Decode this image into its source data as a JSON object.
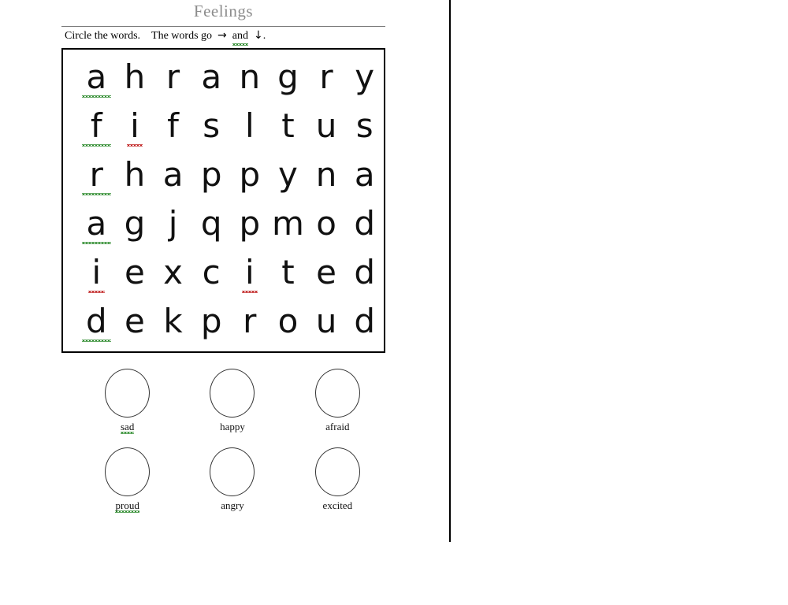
{
  "document": {
    "title": "Feelings",
    "instructions": {
      "part1": "Circle the words.",
      "part2": "The words go",
      "arrow_right": "→",
      "and_word": "and",
      "arrow_down": "↓",
      "period": "."
    }
  },
  "puzzle": {
    "rows": [
      [
        "a",
        "h",
        "r",
        "a",
        "n",
        "g",
        "r",
        "y"
      ],
      [
        "f",
        "i",
        "f",
        "s",
        "l",
        "t",
        "u",
        "s"
      ],
      [
        "r",
        "h",
        "a",
        "p",
        "p",
        "y",
        "n",
        "a"
      ],
      [
        "a",
        "g",
        "j",
        "q",
        "p",
        "m",
        "o",
        "d"
      ],
      [
        "i",
        "e",
        "x",
        "c",
        "i",
        "t",
        "e",
        "d"
      ],
      [
        "d",
        "e",
        "k",
        "p",
        "r",
        "o",
        "u",
        "d"
      ]
    ],
    "spellcheck_marks": [
      {
        "row": 0,
        "col": 0,
        "color": "green"
      },
      {
        "row": 1,
        "col": 0,
        "color": "green"
      },
      {
        "row": 1,
        "col": 1,
        "color": "red"
      },
      {
        "row": 2,
        "col": 0,
        "color": "green"
      },
      {
        "row": 3,
        "col": 0,
        "color": "green"
      },
      {
        "row": 4,
        "col": 0,
        "color": "red"
      },
      {
        "row": 4,
        "col": 4,
        "color": "red"
      },
      {
        "row": 5,
        "col": 0,
        "color": "green"
      }
    ]
  },
  "word_bank": {
    "rows": [
      [
        {
          "word": "sad",
          "spellcheck": "green"
        },
        {
          "word": "happy",
          "spellcheck": "none"
        },
        {
          "word": "afraid",
          "spellcheck": "none"
        }
      ],
      [
        {
          "word": "proud",
          "spellcheck": "green"
        },
        {
          "word": "angry",
          "spellcheck": "none"
        },
        {
          "word": "excited",
          "spellcheck": "none"
        }
      ]
    ]
  },
  "colors": {
    "title": "#8c8c8c",
    "text": "#000000",
    "border": "#000000",
    "spellcheck_green": "#2e8b2e",
    "spellcheck_red": "#c02020",
    "background": "#ffffff"
  }
}
